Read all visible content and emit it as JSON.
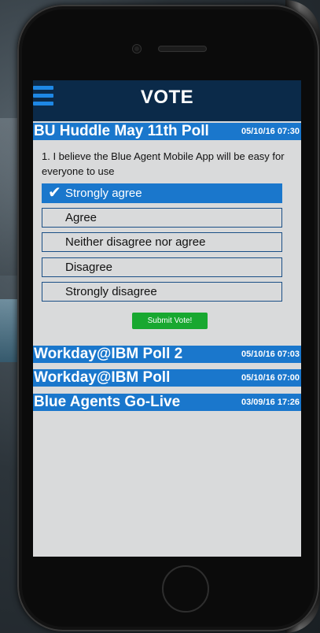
{
  "app": {
    "title": "VOTE"
  },
  "active_poll": {
    "title": "BU Huddle May 11th Poll",
    "date": "05/10/16 07:30",
    "question": "1. I believe the Blue Agent Mobile App will be easy for everyone to use",
    "options": [
      {
        "label": "Strongly agree",
        "selected": true
      },
      {
        "label": "Agree",
        "selected": false
      },
      {
        "label": "Neither disagree nor agree",
        "selected": false
      },
      {
        "label": "Disagree",
        "selected": false
      },
      {
        "label": "Strongly disagree",
        "selected": false
      }
    ],
    "submit_label": "Submit Vote!"
  },
  "other_polls": [
    {
      "title": "Workday@IBM Poll 2",
      "date": "05/10/16 07:03"
    },
    {
      "title": "Workday@IBM Poll",
      "date": "05/10/16 07:00"
    },
    {
      "title": "Blue Agents Go-Live",
      "date": "03/09/16 17:26"
    }
  ],
  "icons": {
    "menu": "hamburger-menu-icon",
    "check": "checkmark-icon"
  },
  "colors": {
    "header": "#0b2a49",
    "accent": "#1a77cc",
    "submit": "#18a830"
  }
}
